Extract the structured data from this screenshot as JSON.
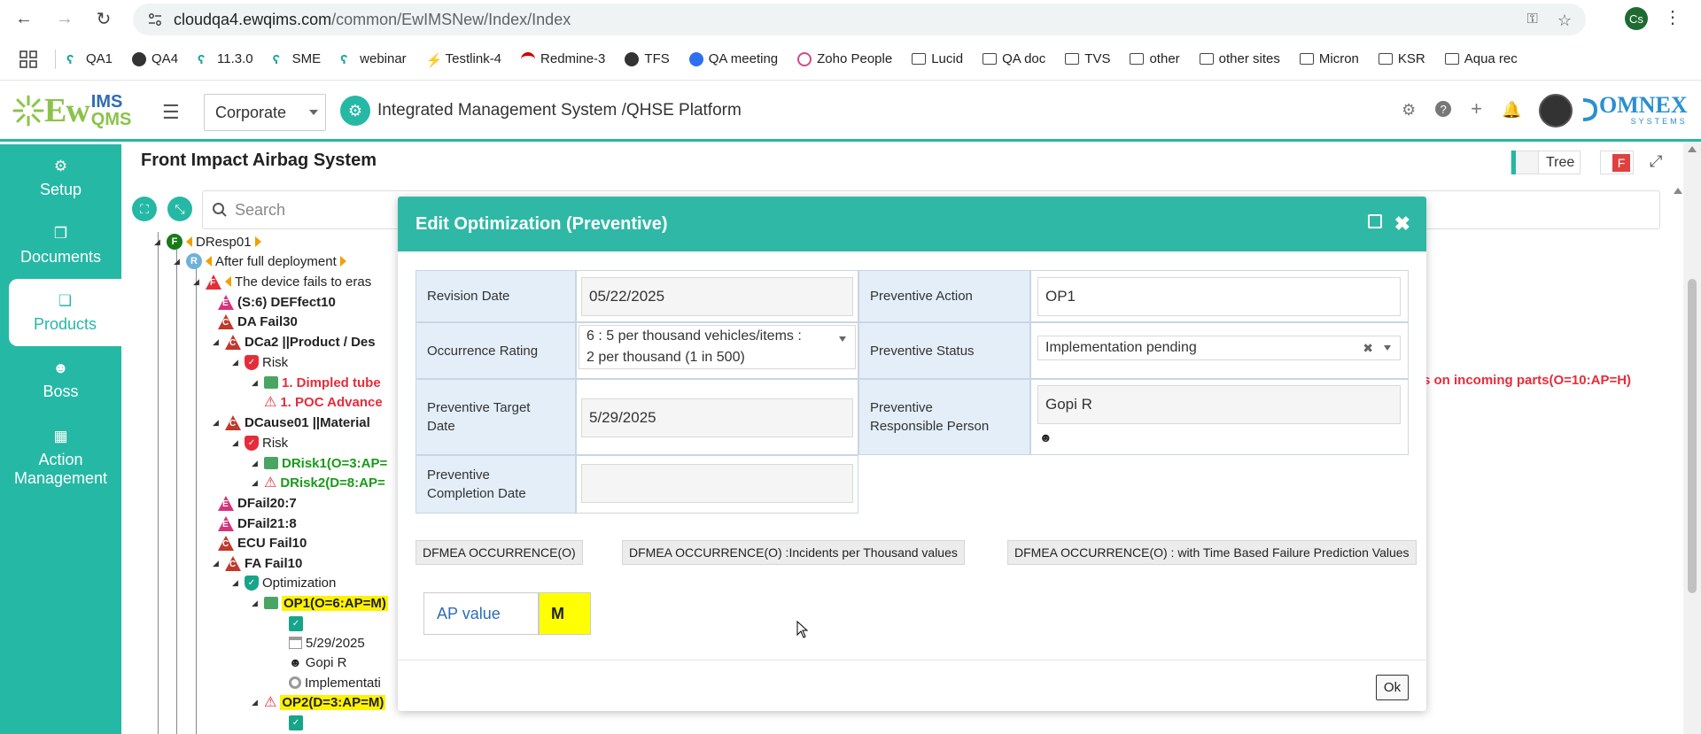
{
  "browser": {
    "url_host": "cloudqa4.ewqims.com",
    "url_path": "/common/EwIMSNew/Index/Index",
    "profile_initials": "Cs",
    "bookmarks": [
      "QA1",
      "QA4",
      "11.3.0",
      "SME",
      "webinar",
      "Testlink-4",
      "Redmine-3",
      "TFS",
      "QA meeting",
      "Zoho People",
      "Lucid",
      "QA doc",
      "TVS",
      "other",
      "other sites",
      "Micron",
      "KSR",
      "Aqua rec"
    ]
  },
  "header": {
    "logo_text": "Ew",
    "logo_ims": "IMS",
    "logo_qms": "QMS",
    "org_select": "Corporate",
    "platform_title": "Integrated Management System /QHSE Platform",
    "brand": "OMNEX",
    "brand_sub": "SYSTEMS",
    "icons": [
      "gear-icon",
      "help-icon",
      "plus-icon",
      "bell-icon"
    ]
  },
  "sidebar": {
    "items": [
      {
        "label": "Setup",
        "icon": "gears-icon"
      },
      {
        "label": "Documents",
        "icon": "copy-icon"
      },
      {
        "label": "Products",
        "icon": "cube-icon",
        "active": true
      },
      {
        "label": "Boss",
        "icon": "user-icon"
      },
      {
        "label": "Action Management",
        "icon": "building-icon"
      }
    ]
  },
  "main": {
    "page_title": "Front Impact Airbag System",
    "tree_toggle": "Tree",
    "f_badge": "F",
    "search_placeholder": "Search",
    "right_red_text": "s on incoming parts(O=10:AP=H)"
  },
  "tree": {
    "nodes": [
      {
        "text": "DResp01"
      },
      {
        "text": "After full deployment"
      },
      {
        "text": "The device fails to eras"
      },
      {
        "text": "(S:6) DEFfect10"
      },
      {
        "text": "DA Fail30"
      },
      {
        "text": "DCa2 ||Product / Des"
      },
      {
        "text": "Risk"
      },
      {
        "text": "1. Dimpled tube"
      },
      {
        "text": "1. POC Advance"
      },
      {
        "text": "DCause01 ||Material"
      },
      {
        "text": "Risk"
      },
      {
        "text": "DRisk1(O=3:AP="
      },
      {
        "text": "DRisk2(D=8:AP="
      },
      {
        "text": "DFail20:7"
      },
      {
        "text": "DFail21:8"
      },
      {
        "text": "ECU Fail10"
      },
      {
        "text": "FA Fail10"
      },
      {
        "text": "Optimization"
      },
      {
        "text": "OP1(O=6:AP=M)"
      },
      {
        "text": "5/29/2025"
      },
      {
        "text": "Gopi R"
      },
      {
        "text": "Implementati"
      },
      {
        "text": "OP2(D=3:AP=M)"
      }
    ]
  },
  "modal": {
    "title": "Edit Optimization (Preventive)",
    "fields": {
      "revision_date_label": "Revision Date",
      "revision_date_value": "05/22/2025",
      "occurrence_rating_label": "Occurrence Rating",
      "occurrence_rating_value_line1": "6 : 5 per thousand vehicles/items :",
      "occurrence_rating_value_line2": "2 per thousand (1 in 500)",
      "preventive_target_date_label_1": "Preventive Target",
      "preventive_target_date_label_2": "Date",
      "preventive_target_date_value": "5/29/2025",
      "preventive_completion_date_label_1": "Preventive",
      "preventive_completion_date_label_2": "Completion Date",
      "preventive_completion_date_value": "",
      "preventive_action_label": "Preventive Action",
      "preventive_action_value": "OP1",
      "preventive_status_label": "Preventive Status",
      "preventive_status_value": "Implementation pending",
      "preventive_responsible_label_1": "Preventive",
      "preventive_responsible_label_2": "Responsible Person",
      "preventive_responsible_value": "Gopi R"
    },
    "tabs": [
      "DFMEA OCCURRENCE(O)",
      "DFMEA OCCURRENCE(O) :Incidents per Thousand values",
      "DFMEA OCCURRENCE(O) : with Time Based Failure Prediction Values"
    ],
    "ap_label": "AP value",
    "ap_value": "M",
    "ok_label": "Ok"
  }
}
